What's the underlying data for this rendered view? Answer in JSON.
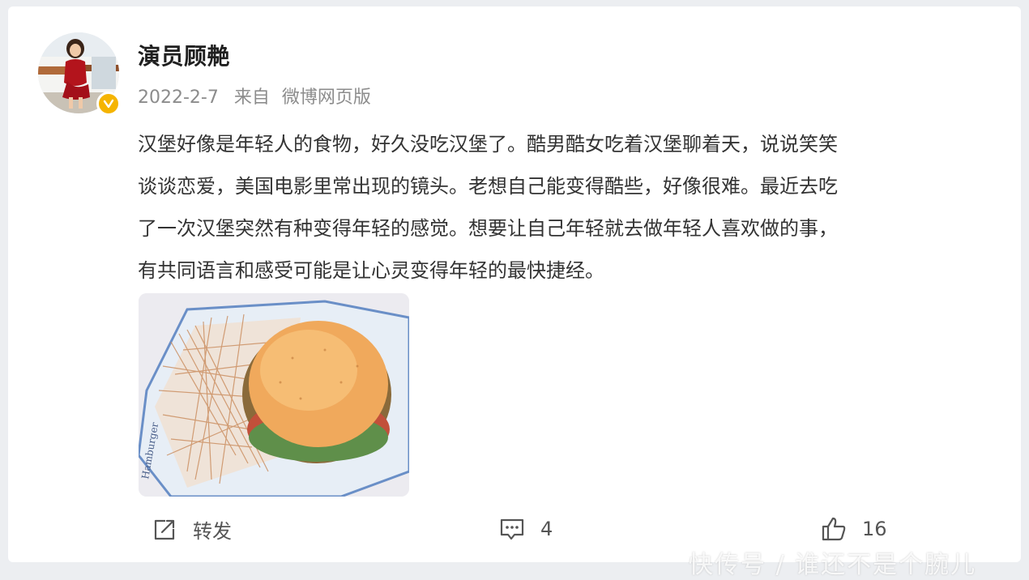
{
  "post": {
    "username": "演员顾艴",
    "date": "2022-2-7",
    "source_prefix": "来自",
    "source": "微博网页版",
    "lines": [
      "汉堡好像是年轻人的食物，好久没吃汉堡了。酷男酷女吃着汉堡聊着天，说说笑笑",
      "谈谈恋爱，美国电影里常出现的镜头。老想自己能变得酷些，好像很难。最近去吃",
      "了一次汉堡突然有种变得年轻的感觉。想要让自己年轻就去做年轻人喜欢做的事，",
      "有共同语言和感受可能是让心灵变得年轻的最快捷经。"
    ],
    "image_alt": "Hamburger watercolor sketch",
    "image_text": "Hamburger"
  },
  "actions": {
    "repost_label": "转发",
    "comment_count": "4",
    "like_count": "16"
  },
  "watermark": "快传号 / 谁还不是个腕儿",
  "icons": {
    "repost": "share-icon",
    "comment": "comment-icon",
    "like": "thumbs-up-icon",
    "verified": "verified-badge-icon"
  },
  "colors": {
    "verified": "#f5b400",
    "text": "#333333",
    "meta": "#8c8c8c"
  }
}
